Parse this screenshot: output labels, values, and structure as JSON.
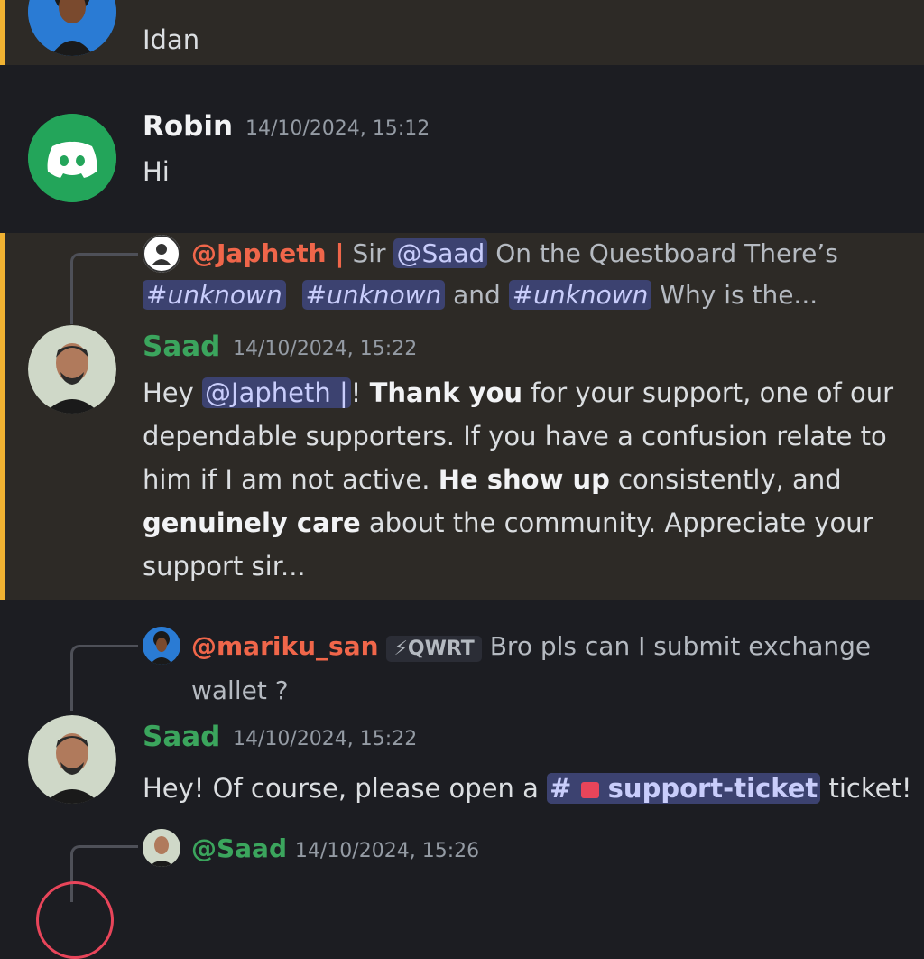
{
  "top_message": {
    "text": "Idan"
  },
  "robin_message": {
    "author": "Robin",
    "timestamp": "14/10/2024, 15:12",
    "text": "Hi"
  },
  "saad_message_1": {
    "reply": {
      "mention": "@Japheth |",
      "text_a": " Sir ",
      "mention2": "@Saad",
      "text_b": " On the Questboard There’s",
      "channel_label": "unknown",
      "and_text": " and ",
      "tail": " Why is the..."
    },
    "author": "Saad",
    "timestamp": "14/10/2024, 15:22",
    "parts": {
      "p1": "Hey ",
      "mention": "@Japheth |",
      "p2": "! ",
      "b1": "Thank you",
      "p3": " for your support, one of our dependable supporters. If you have a confusion relate to him if I am not active. ",
      "b2": "He show up",
      "p4": " consistently, and ",
      "b3": "genuinely care",
      "p5": " about the community. Appreciate your support sir..."
    }
  },
  "saad_message_2": {
    "reply": {
      "mention": "@mariku_san",
      "tag": "⚡QWRT",
      "text": " Bro pls can I submit exchange wallet ?"
    },
    "author": "Saad",
    "timestamp": "14/10/2024, 15:22",
    "text_a": "Hey! Of course, please open a ",
    "channel": "support-ticket",
    "text_b": " ticket!"
  },
  "bottom_reply": {
    "mention": "@Saad",
    "timestamp": "14/10/2024, 15:26"
  },
  "colors": {
    "highlight_bar": "#f0b232",
    "saad_name": "#3ba55d",
    "mention_red": "#f0664a",
    "discord_green": "#23a55a"
  }
}
